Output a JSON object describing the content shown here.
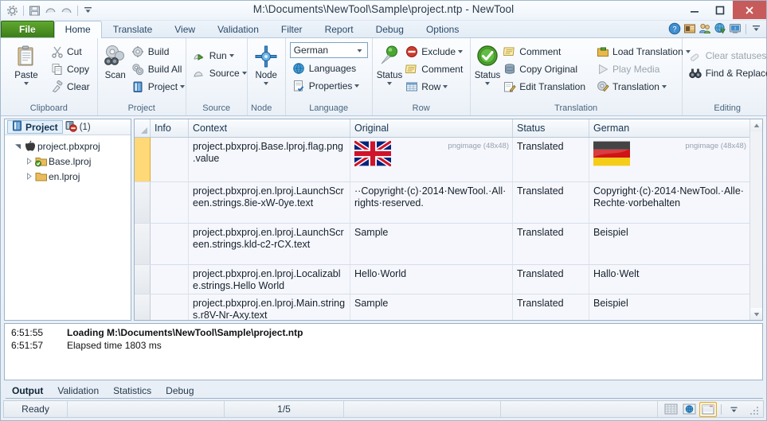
{
  "window": {
    "title": "M:\\Documents\\NewTool\\Sample\\project.ntp - NewTool",
    "minimize_label": "–",
    "maximize_label": "□",
    "close_label": "✕"
  },
  "quick_access": {
    "items": [
      {
        "name": "app-menu-icon",
        "label": "gear-icon"
      },
      {
        "name": "save-icon",
        "label": "save-icon"
      },
      {
        "name": "undo-icon",
        "label": "undo-icon"
      },
      {
        "name": "redo-icon",
        "label": "redo-icon"
      },
      {
        "name": "customize-qat-icon",
        "label": "chevron-down-icon"
      }
    ]
  },
  "tabs": {
    "file": "File",
    "items": [
      "Home",
      "Translate",
      "View",
      "Validation",
      "Filter",
      "Report",
      "Debug",
      "Options"
    ],
    "active": "Home",
    "right_icons": [
      "help-icon",
      "glossary-icon",
      "users-icon",
      "globe-download-icon",
      "about-icon",
      "ribbon-options-icon"
    ]
  },
  "ribbon": {
    "groups": [
      {
        "label": "Clipboard",
        "has_dialog_launcher": false,
        "big": [
          {
            "label": "Paste",
            "icon": "paste-icon",
            "has_menu": true
          }
        ],
        "small": [
          {
            "label": "Cut",
            "icon": "cut-icon",
            "disabled": false
          },
          {
            "label": "Copy",
            "icon": "copy-icon",
            "disabled": false
          },
          {
            "label": "Clear",
            "icon": "clear-icon",
            "disabled": false
          }
        ]
      },
      {
        "label": "Project",
        "has_dialog_launcher": true,
        "big": [
          {
            "label": "Scan",
            "icon": "scan-icon",
            "has_menu": false
          }
        ],
        "small": [
          {
            "label": "Build",
            "icon": "build-icon",
            "disabled": false
          },
          {
            "label": "Build All",
            "icon": "build-all-icon",
            "disabled": false
          },
          {
            "label": "Project",
            "icon": "project-icon",
            "disabled": false,
            "has_menu": true
          }
        ]
      },
      {
        "label": "Source",
        "has_dialog_launcher": true,
        "big": [],
        "small": [
          {
            "label": "Run",
            "icon": "run-icon",
            "disabled": false,
            "has_menu": true
          },
          {
            "label": "Source",
            "icon": "source-icon",
            "disabled": false,
            "has_menu": true
          }
        ]
      },
      {
        "label": "Node",
        "has_dialog_launcher": true,
        "big": [
          {
            "label": "Node",
            "icon": "node-icon",
            "has_menu": true
          }
        ],
        "small": []
      },
      {
        "label": "Language",
        "has_dialog_launcher": true,
        "combo": {
          "value": "German",
          "name": "language-combo"
        },
        "big": [],
        "small": [
          {
            "label": "Languages",
            "icon": "languages-icon",
            "disabled": false
          },
          {
            "label": "Properties",
            "icon": "properties-icon",
            "disabled": false,
            "has_menu": true
          }
        ]
      },
      {
        "label": "Row",
        "has_dialog_launcher": false,
        "big": [
          {
            "label": "Status",
            "icon": "pin-status-icon",
            "has_menu": true
          }
        ],
        "small": [
          {
            "label": "Exclude",
            "icon": "exclude-icon",
            "disabled": false,
            "has_menu": true
          },
          {
            "label": "Comment",
            "icon": "comment-icon",
            "disabled": false
          },
          {
            "label": "Row",
            "icon": "row-icon",
            "disabled": false,
            "has_menu": true
          }
        ]
      },
      {
        "label": "Translation",
        "has_dialog_launcher": true,
        "big": [
          {
            "label": "Status",
            "icon": "check-status-icon",
            "has_menu": true
          }
        ],
        "small": [
          {
            "label": "Comment",
            "icon": "comment-icon",
            "disabled": false
          },
          {
            "label": "Copy Original",
            "icon": "copy-original-icon",
            "disabled": false
          },
          {
            "label": "Edit Translation",
            "icon": "edit-translation-icon",
            "disabled": false
          }
        ],
        "small2": [
          {
            "label": "Load Translation",
            "icon": "load-translation-icon",
            "disabled": false,
            "has_menu": true
          },
          {
            "label": "Play Media",
            "icon": "play-media-icon",
            "disabled": true
          },
          {
            "label": "Translation",
            "icon": "translation-icon",
            "disabled": false,
            "has_menu": true
          }
        ]
      },
      {
        "label": "Editing",
        "has_dialog_launcher": false,
        "big": [],
        "small": [
          {
            "label": "Clear statuses",
            "icon": "clear-statuses-icon",
            "disabled": true,
            "has_menu": true
          },
          {
            "label": "Find & Replace",
            "icon": "find-replace-icon",
            "disabled": false,
            "has_menu": true
          }
        ]
      }
    ]
  },
  "project_panel": {
    "tab_label": "Project",
    "badge_icon": "error-filter-icon",
    "badge_count": "(1)",
    "tree": [
      {
        "label": "project.pbxproj",
        "icon": "apple-icon",
        "depth": 0,
        "expanded": true
      },
      {
        "label": "Base.lproj",
        "icon": "folder-check-icon",
        "depth": 1,
        "expanded": false
      },
      {
        "label": "en.lproj",
        "icon": "folder-icon",
        "depth": 1,
        "expanded": false
      }
    ]
  },
  "grid": {
    "columns": [
      "Info",
      "Context",
      "Original",
      "Status",
      "German"
    ],
    "rows": [
      {
        "selected": true,
        "info": "",
        "context": "project.pbxproj.Base.lproj.flag.png.value",
        "original": {
          "type": "image",
          "flag": "uk",
          "tag": "pngimage (48x48)"
        },
        "status": "Translated",
        "german": {
          "type": "image",
          "flag": "de",
          "tag": "pngimage (48x48)"
        }
      },
      {
        "selected": false,
        "info": "",
        "context": "project.pbxproj.en.lproj.LaunchScreen.strings.8ie-xW-0ye.text",
        "original": {
          "type": "text",
          "value": "··Copyright·(c)·2014·NewTool.·All·rights·reserved."
        },
        "status": "Translated",
        "german": {
          "type": "text",
          "value": "Copyright·(c)·2014·NewTool.·Alle·Rechte·vorbehalten"
        }
      },
      {
        "selected": false,
        "info": "",
        "context": "project.pbxproj.en.lproj.LaunchScreen.strings.kld-c2-rCX.text",
        "original": {
          "type": "text",
          "value": "Sample"
        },
        "status": "Translated",
        "german": {
          "type": "text",
          "value": "Beispiel"
        }
      },
      {
        "selected": false,
        "info": "",
        "context": "project.pbxproj.en.lproj.Localizable.strings.Hello World",
        "original": {
          "type": "text",
          "value": "Hello·World"
        },
        "status": "Translated",
        "german": {
          "type": "text",
          "value": "Hallo·Welt"
        }
      },
      {
        "selected": false,
        "info": "",
        "context": "project.pbxproj.en.lproj.Main.strings.r8V-Nr-Axy.text",
        "original": {
          "type": "text",
          "value": "Sample"
        },
        "status": "Translated",
        "german": {
          "type": "text",
          "value": "Beispiel"
        }
      }
    ]
  },
  "output": {
    "lines": [
      {
        "time": "6:51:55",
        "message": "Loading M:\\Documents\\NewTool\\Sample\\project.ntp",
        "bold": true
      },
      {
        "time": "6:51:57",
        "message": "Elapsed time  1803 ms",
        "bold": false
      }
    ],
    "tabs": [
      "Output",
      "Validation",
      "Statistics",
      "Debug"
    ],
    "active_tab": "Output"
  },
  "statusbar": {
    "status": "Ready",
    "position": "1/5",
    "view_buttons": [
      {
        "name": "grid-view-button",
        "icon": "grid-icon",
        "active": false
      },
      {
        "name": "web-view-button",
        "icon": "globe-icon",
        "active": false
      },
      {
        "name": "form-view-button",
        "icon": "form-icon",
        "active": true
      },
      {
        "name": "view-options-button",
        "icon": "chevron-down-icon",
        "active": false
      }
    ]
  },
  "colors": {
    "accent_green": "#4e9a20",
    "selection_orange": "#ffd977",
    "close_red": "#c75b5b",
    "row_bg": "#f6f7fd"
  }
}
